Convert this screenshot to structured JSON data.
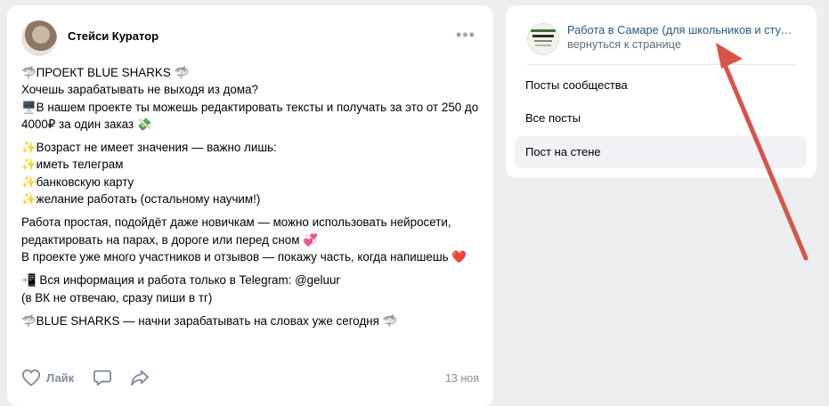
{
  "post": {
    "author": "Стейси Куратор",
    "more_icon": "more-horizontal-icon",
    "paragraphs": [
      "🦈ПРОЕКТ BLUE SHARKS 🦈\nХочешь зарабатывать не выходя из дома?\n🖥️В нашем проекте ты можешь редактировать тексты и получать за это от 250 до 4000₽ за один заказ 💸",
      "✨Возраст не имеет значения — важно лишь:\n✨иметь телеграм\n✨банковскую карту\n✨желание работать (остальному научим!)",
      "Работа простая, подойдёт даже новичкам — можно использовать нейросети, редактировать на парах, в дороге или перед сном 💞\nВ проекте уже много участников и отзывов — покажу часть, когда напишешь ❤️",
      "📲 Вся информация и работа только в Telegram: @geluur\n(в ВК не отвечаю, сразу пиши в тг)",
      "🦈BLUE SHARKS — начни зарабатывать на словах уже сегодня 🦈"
    ],
    "like_label": "Лайк",
    "date": "13 ноя",
    "icons": {
      "like": "heart-icon",
      "comment": "comment-icon",
      "share": "share-icon"
    }
  },
  "sidebar": {
    "group_name": "Работа в Самаре (для школьников и студентов)",
    "back_link": "вернуться к странице",
    "menu": [
      {
        "label": "Посты сообщества",
        "active": false
      },
      {
        "label": "Все посты",
        "active": false
      },
      {
        "label": "Пост на стене",
        "active": true
      }
    ]
  },
  "colors": {
    "background": "#edeef0",
    "card": "#ffffff",
    "link": "#2a5885",
    "muted": "#818c99",
    "active_item": "#f0f2f5",
    "annotation_arrow": "#d9534a"
  }
}
